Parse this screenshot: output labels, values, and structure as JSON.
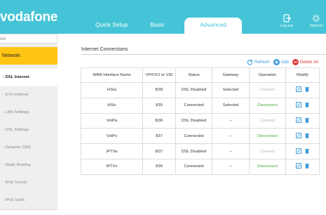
{
  "brand": {
    "logo": "vodafone",
    "accent": "#44c4d6",
    "highlight": "#ffc414"
  },
  "header": {
    "tabs": [
      {
        "label": "Quick Setup",
        "active": false
      },
      {
        "label": "Basic",
        "active": false
      },
      {
        "label": "Advanced",
        "active": true
      }
    ],
    "logout_label": "Log out",
    "reboot_label": "Reboot"
  },
  "sidebar": {
    "search_placeholder": "rch",
    "section": "Network",
    "items": [
      {
        "label": "- DSL Internet",
        "active": true
      },
      {
        "label": "- ETH Internet",
        "active": false
      },
      {
        "label": "- LAN Settings",
        "active": false
      },
      {
        "label": "- DSL Settings",
        "active": false
      },
      {
        "label": "- Dynamic DNS",
        "active": false
      },
      {
        "label": "- Static Routing",
        "active": false
      },
      {
        "label": "- IPv6 Tunnel",
        "active": false
      },
      {
        "label": "- IPv6 Swith",
        "active": false
      }
    ]
  },
  "main": {
    "title": "Internet Connections",
    "actions": {
      "refresh": "Refresh",
      "add": "Add",
      "delete_all": "Delete All"
    },
    "columns": [
      "WAN Interface Name",
      "VPI/VCI or VID",
      "Status",
      "Gateway",
      "Operation",
      "Modify"
    ],
    "rows": [
      {
        "name": "HSIa",
        "vpi": "8/35",
        "status": "DSL Disabled",
        "gateway": "Selected",
        "operation": "Connect"
      },
      {
        "name": "HSIv",
        "vpi": "835",
        "status": "Connected",
        "gateway": "Selected",
        "operation": "Disconnect"
      },
      {
        "name": "VoIPa",
        "vpi": "8/36",
        "status": "DSL Disabled",
        "gateway": "--",
        "operation": "Connect"
      },
      {
        "name": "VoIPv",
        "vpi": "837",
        "status": "Connected",
        "gateway": "--",
        "operation": "Disconnect"
      },
      {
        "name": "IPTVa",
        "vpi": "8/37",
        "status": "DSL Disabled",
        "gateway": "--",
        "operation": "Connect"
      },
      {
        "name": "IPTVv",
        "vpi": "836",
        "status": "Connected",
        "gateway": "--",
        "operation": "Disconnect"
      }
    ]
  }
}
